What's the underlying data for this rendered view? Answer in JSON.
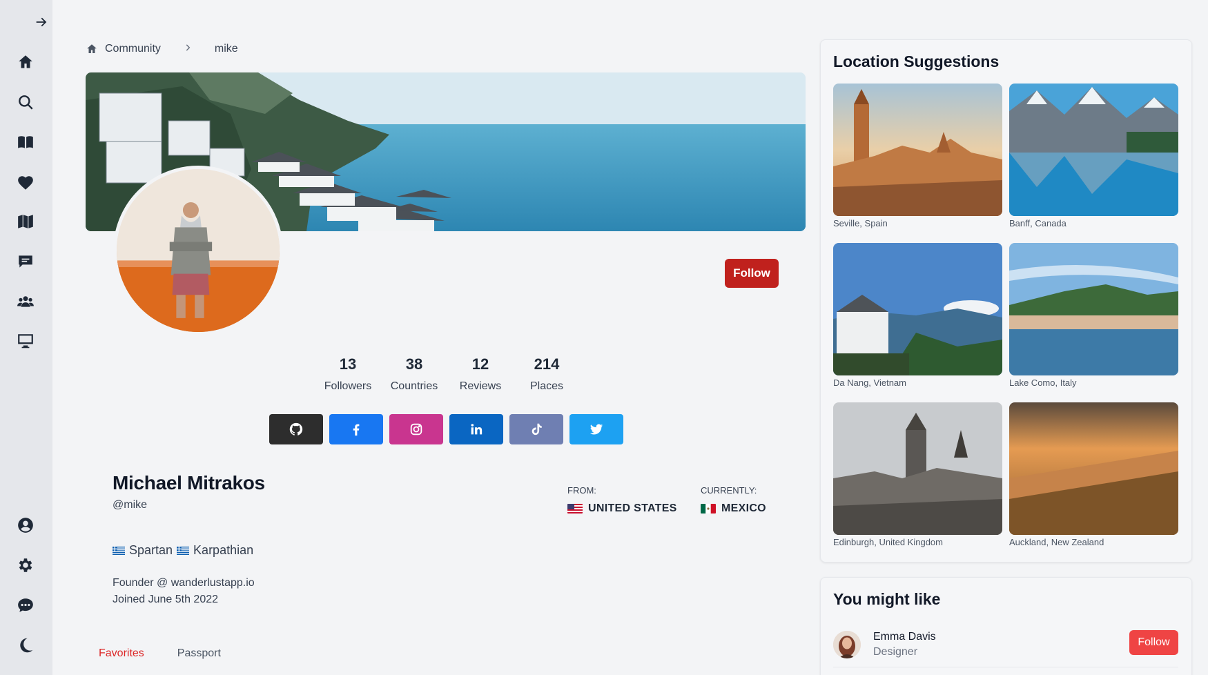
{
  "sidebar": {
    "top_items": [
      "expand-icon",
      "home-icon",
      "search-icon",
      "book-icon",
      "heart-icon",
      "map-icon",
      "messages-icon",
      "users-icon",
      "monitor-icon"
    ],
    "bottom_items": [
      "profile-icon",
      "gear-icon",
      "chat-icon",
      "moon-icon"
    ]
  },
  "breadcrumb": {
    "items": [
      "Community",
      "mike"
    ]
  },
  "profile": {
    "follow_label": "Follow",
    "stats": [
      {
        "value": "13",
        "label": "Followers"
      },
      {
        "value": "38",
        "label": "Countries"
      },
      {
        "value": "12",
        "label": "Reviews"
      },
      {
        "value": "214",
        "label": "Places"
      }
    ],
    "socials": [
      "github-icon",
      "facebook-icon",
      "instagram-icon",
      "linkedin-icon",
      "tiktok-icon",
      "twitter-icon"
    ],
    "name": "Michael Mitrakos",
    "handle": "@mike",
    "from": {
      "label": "FROM:",
      "country": "UNITED STATES"
    },
    "currently": {
      "label": "CURRENTLY:",
      "country": "MEXICO"
    },
    "heritage": [
      "Spartan",
      "Karpathian"
    ],
    "bio_line1": "Founder @ wanderlustapp.io",
    "bio_line2": "Joined June 5th 2022"
  },
  "tabs": [
    "Favorites",
    "Passport"
  ],
  "location_suggestions": {
    "title": "Location Suggestions",
    "items": [
      {
        "name": "Seville, Spain"
      },
      {
        "name": "Banff, Canada"
      },
      {
        "name": "Da Nang, Vietnam"
      },
      {
        "name": "Lake Como, Italy"
      },
      {
        "name": "Edinburgh, United Kingdom"
      },
      {
        "name": "Auckland, New Zealand"
      }
    ]
  },
  "you_might_like": {
    "title": "You might like",
    "people": [
      {
        "name": "Emma Davis",
        "role": "Designer",
        "follow_label": "Follow"
      }
    ]
  },
  "colors": {
    "accent_red": "#c0211d",
    "tab_active": "#dc2626",
    "github": "#2d2d2d",
    "facebook": "#1877f2",
    "instagram": "#c9358f",
    "linkedin": "#0a66c2",
    "tiktok": "#6f7fb2",
    "twitter": "#1da1f2"
  }
}
